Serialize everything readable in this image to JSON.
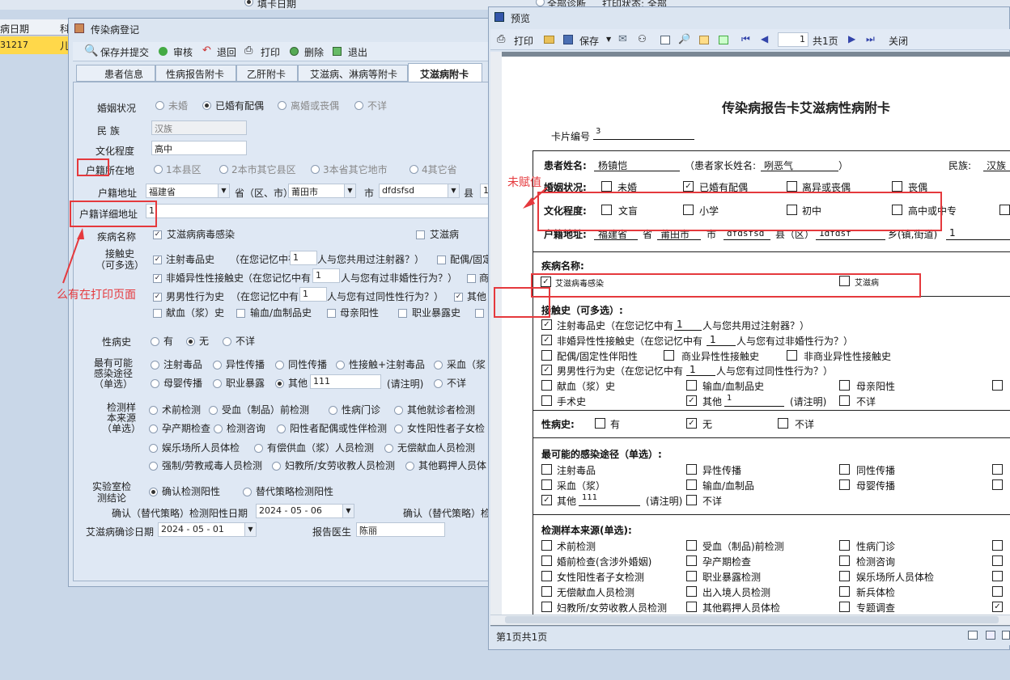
{
  "bg": {
    "fill_date": "填卡日期",
    "col1": "病日期",
    "col2": "科",
    "row_val": "31217",
    "row_val2": "儿",
    "top_right": "全部诊断",
    "print_state": "打印状态: 全部"
  },
  "reg": {
    "title": "传染病登记",
    "toolbar": [
      "保存并提交",
      "审核",
      "退回",
      "打印",
      "删除",
      "退出"
    ],
    "tabs": [
      "患者信息",
      "性病报告附卡",
      "乙肝附卡",
      "艾滋病、淋病等附卡",
      "艾滋病附卡"
    ],
    "marital": {
      "label": "婚姻状况",
      "opts": [
        "未婚",
        "已婚有配偶",
        "离婚或丧偶",
        "不详"
      ]
    },
    "nation": {
      "label": "民    族",
      "value": "汉族"
    },
    "edu": {
      "label": "文化程度",
      "value": "高中"
    },
    "hj": {
      "label": "户籍所在地",
      "opts": [
        "1本县区",
        "2本市其它县区",
        "3本省其它地市",
        "4其它省"
      ]
    },
    "addr": {
      "label": "户籍地址",
      "prov": "福建省",
      "prov_s": "省（区、市）",
      "city": "莆田市",
      "city_s": "市",
      "county": "dfdsfsd",
      "county_s": "县",
      "more": "1"
    },
    "detail": {
      "label": "户籍详细地址",
      "value": "1"
    },
    "disease": {
      "label": "疾病名称",
      "a": "艾滋病病毒感染",
      "b": "艾滋病"
    },
    "contact": {
      "label": "接触史\n（可多选）",
      "r1a": "注射毒品史",
      "r1b": "（在您记忆中有",
      "r1v": "1",
      "r1c": "人与您共用过注射器？）",
      "r1d": "配偶/固定",
      "r2a": "非婚异性性接触史",
      "r2b": "（在您记忆中有",
      "r2v": "1",
      "r2c": "人与您有过非婚性行为？）",
      "r2d": "商",
      "r3a": "男男性行为史",
      "r3b": "（在您记忆中有",
      "r3v": "1",
      "r3c": "人与您有过同性性行为？）",
      "r3d": "其他",
      "r4": [
        "献血（浆）史",
        "输血/血制品史",
        "母亲阳性",
        "职业暴露史"
      ]
    },
    "std": {
      "label": "性病史",
      "opts": [
        "有",
        "无",
        "不详"
      ]
    },
    "route": {
      "label": "最有可能\n感染途径\n（单选）",
      "r1": [
        "注射毒品",
        "异性传播",
        "同性传播",
        "性接触+注射毒品",
        "采血（浆"
      ],
      "r2": [
        "母婴传播",
        "职业暴露",
        "其他"
      ],
      "other_val": "111",
      "note": "(请注明)",
      "unk": "不详"
    },
    "sample": {
      "label": "检测样\n本来源\n（单选）",
      "r1": [
        "术前检测",
        "受血（制品）前检测",
        "性病门诊",
        "其他就诊者检测"
      ],
      "r2": [
        "孕产期检查",
        "检测咨询",
        "阳性者配偶或性伴检测",
        "女性阳性者子女检"
      ],
      "r3": [
        "娱乐场所人员体检",
        "有偿供血（浆）人员检测",
        "无偿献血人员检测"
      ],
      "r4": [
        "强制/劳教戒毒人员检测",
        "妇教所/女劳收教人员检测",
        "其他羁押人员体"
      ]
    },
    "lab": {
      "label": "实验室检\n测结论",
      "opts": [
        "确认检测阳性",
        "替代策略检测阳性"
      ]
    },
    "confirm_date": {
      "label": "确认（替代策略）检测阳性日期",
      "value": "2024 - 05 - 06",
      "label2": "确认（替代策略）检"
    },
    "aids_date": {
      "label": "艾滋病确诊日期",
      "value": "2024 - 05 - 01"
    },
    "doctor": {
      "label": "报告医生",
      "value": "陈丽"
    }
  },
  "preview": {
    "title": "预览",
    "toolbar": {
      "print": "打印",
      "save": "保存",
      "page": "1",
      "of": "共1页",
      "close": "关闭"
    },
    "doc_title": "传染病报告卡艾滋病性病附卡",
    "card_no_label": "卡片编号",
    "card_no": "3",
    "name_label": "患者姓名:",
    "name": "杨镇恺",
    "parent_label": "（患者家长姓名:",
    "parent": "咧恶气",
    "paren_close": "）",
    "ethnic_label": "民族:",
    "ethnic": "汉族",
    "marital_label": "婚姻状况:",
    "marital": [
      "未婚",
      "已婚有配偶",
      "离异或丧偶",
      "丧偶"
    ],
    "edu_label": "文化程度:",
    "edu": [
      "文盲",
      "小学",
      "初中",
      "高中或中专"
    ],
    "addr_label": "户籍地址:",
    "prov": "福建省",
    "prov_s": "省",
    "city": "莆田市",
    "city_s": "市",
    "county": "dfdsfsd",
    "county_s": "县（区）",
    "town": "1dfdsf",
    "town_s": "乡(镇,街道)",
    "town_v": "1",
    "disease_label": "疾病名称:",
    "disease": [
      "艾滋病毒感染",
      "艾滋病"
    ],
    "contact_label": "接触史（可多选）:",
    "c1": "注射毒品史（在您记忆中有",
    "c1v": "1",
    "c1b": "人与您共用过注射器？）",
    "c2": "非婚异性性接触史（在您记忆中有",
    "c2v": "1",
    "c2b": "人与您有过非婚性行为？）",
    "c3": [
      "配偶/固定性伴阳性",
      "商业异性性接触史",
      "非商业异性性接触史"
    ],
    "c4": "男男性行为史（在您记忆中有",
    "c4v": "1",
    "c4b": "人与您有过同性性行为？）",
    "c5": [
      "献血（浆）史",
      "输血/血制品史",
      "母亲阳性"
    ],
    "c6": [
      "手术史",
      "其他"
    ],
    "c6v": "1",
    "c6note": "(请注明)",
    "c6unk": "不详",
    "std_label": "性病史:",
    "std": [
      "有",
      "无",
      "不详"
    ],
    "route_label": "最可能的感染途径（单选）:",
    "route1": [
      "注射毒品",
      "异性传播",
      "同性传播"
    ],
    "route2": [
      "采血（浆）",
      "输血/血制品",
      "母婴传播"
    ],
    "route3": "其他",
    "route3v": "111",
    "route3note": "(请注明)",
    "route3unk": "不详",
    "sample_label": "检测样本来源(单选):",
    "s1": [
      "术前检测",
      "受血（制品)前检测",
      "性病门诊"
    ],
    "s2": [
      "婚前检查(含涉外婚姻)",
      "孕产期检查",
      "检测咨询"
    ],
    "s3": [
      "女性阳性者子女检测",
      "职业暴露检测",
      "娱乐场所人员体检"
    ],
    "s4": [
      "无偿献血人员检测",
      "出入境人员检测",
      "新兵体检"
    ],
    "s5": [
      "妇教所/女劳收教人员检测",
      "其他羁押人员体检",
      "专题调查"
    ],
    "status": "第1页共1页"
  },
  "notes": {
    "n1": "未赋值",
    "n2": "么有在打印页面"
  }
}
